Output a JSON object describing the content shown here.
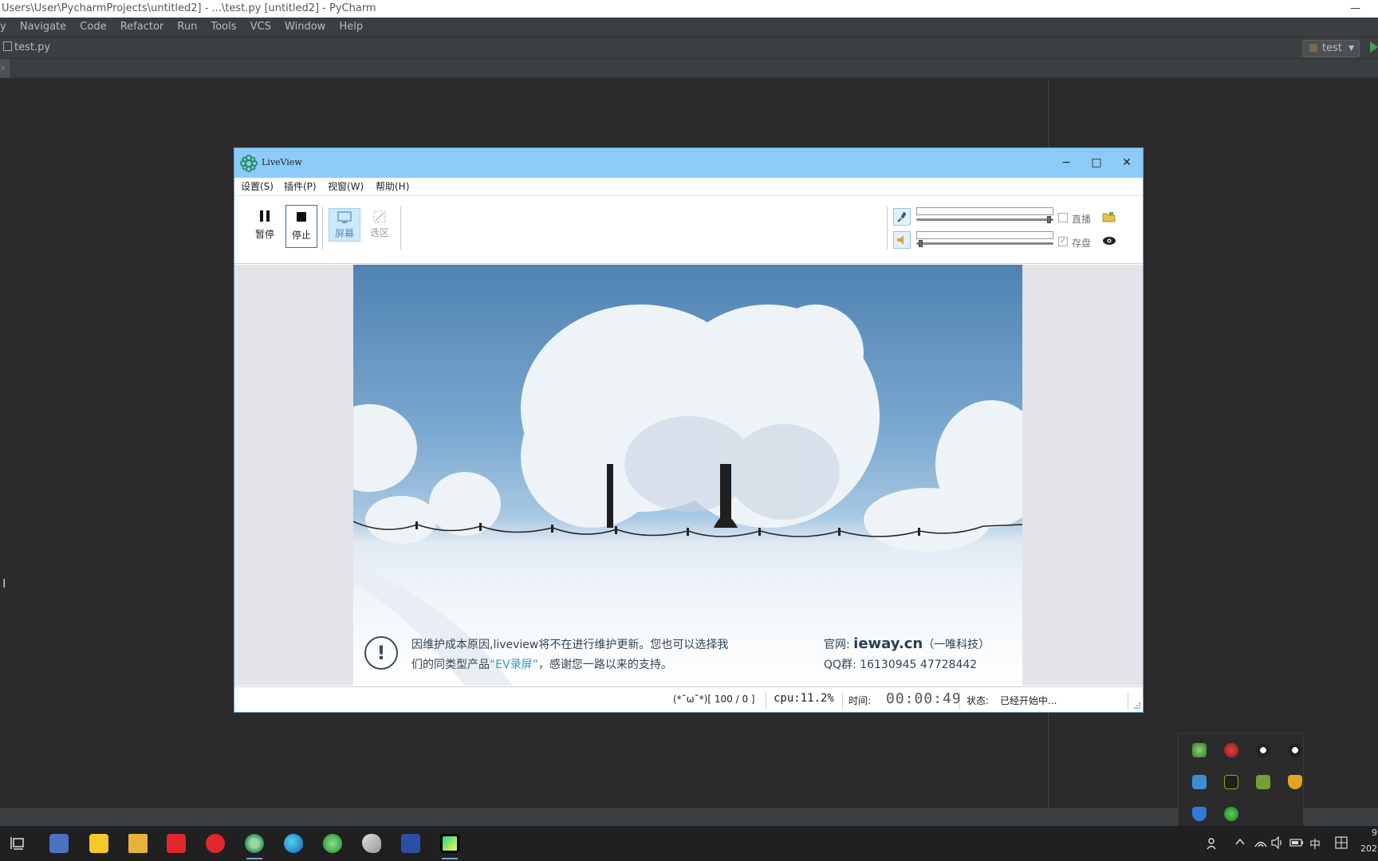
{
  "pycharm": {
    "title": "Users\\User\\PycharmProjects\\untitled2] - ...\\test.py [untitled2] - PyCharm",
    "minimize_glyph": "—",
    "menu_fragment": "y",
    "menu": [
      "Navigate",
      "Code",
      "Refactor",
      "Run",
      "Tools",
      "VCS",
      "Window",
      "Help"
    ],
    "file_tab": "test.py",
    "run_config": "test",
    "run_config_caret": "▼",
    "tab_close": "×",
    "caret_glyph": "I"
  },
  "liveview": {
    "title": "LiveView",
    "controls": {
      "minimize": "−",
      "maximize": "□",
      "close": "✕"
    },
    "menu": [
      "设置(S)",
      "插件(P)",
      "视窗(W)",
      "帮助(H)"
    ],
    "toolbar": {
      "pause": "暂停",
      "stop": "停止",
      "screen": "屏幕",
      "region": "选区"
    },
    "audio": {
      "live_label": "直播",
      "live_checked": false,
      "save_label": "存盘",
      "save_checked": true,
      "mic_level": 0.98,
      "speaker_level": 0.02
    },
    "poster": {
      "notice_line1": "因维护成本原因,liveview将不在进行维护更新。您也可以选择我",
      "notice_line2_pre": "们的同类型产品",
      "notice_line2_hl": "“EV录屏”",
      "notice_line2_post": "，感谢您一路以来的支持。",
      "notice_icon": "!",
      "site_prefix": "官网: ",
      "site_domain": "ieway.cn",
      "site_suffix": "（一唯科技）",
      "qq": "QQ群: 16130945  47728442"
    },
    "status": {
      "fps": "(*˘ω˘*)[ 100 / 0 ]",
      "cpu": "cpu:11.2%",
      "time_label": "时间:",
      "time": "00:00:49",
      "state_label": "状态:",
      "state": "已经开始中..."
    }
  },
  "taskbar": {
    "ime": "中",
    "clock_partial": "9",
    "date_partial": "202"
  },
  "colors": {
    "ide_bg": "#2b2b2b",
    "liveview_title": "#8ccbf7",
    "accent_link": "#2c98c8"
  }
}
